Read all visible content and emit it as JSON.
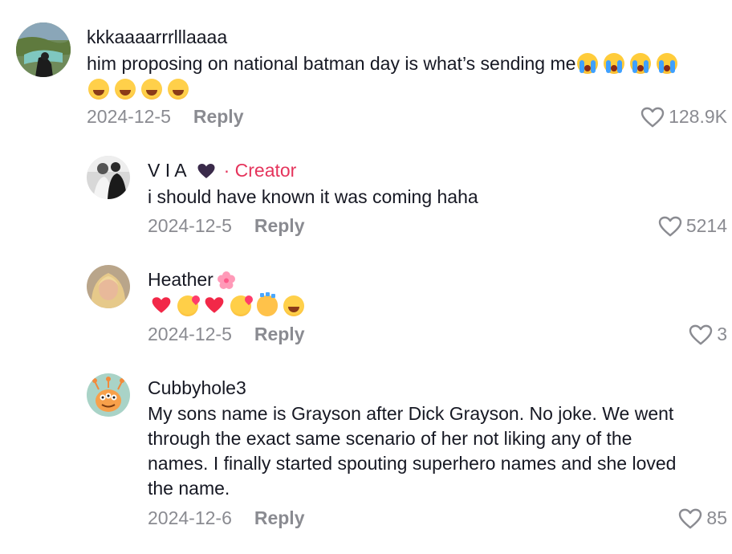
{
  "comments": [
    {
      "username": "kkkaaaarrrlllaaaa",
      "text": "him proposing on national batman day is what’s sending me",
      "text_emojis": [
        "crying-face",
        "crying-face",
        "crying-face",
        "crying-face"
      ],
      "emoji_line": [
        "laughing-face",
        "laughing-face",
        "laughing-face",
        "laughing-face"
      ],
      "date": "2024-12-5",
      "reply_label": "Reply",
      "likes": "128.9K"
    },
    {
      "username": "V I A",
      "badge": "· Creator",
      "text": "i should have known it was coming haha",
      "date": "2024-12-5",
      "reply_label": "Reply",
      "likes": "5214"
    },
    {
      "username": "Heather",
      "emoji_line": [
        "red-heart",
        "smiling-hearts-face",
        "red-heart",
        "smiling-hearts-face",
        "clapping-hands",
        "laughing-face"
      ],
      "date": "2024-12-5",
      "reply_label": "Reply",
      "likes": "3"
    },
    {
      "username": "Cubbyhole3",
      "text_lines": [
        "My sons name is Grayson after Dick Grayson. No joke. We went",
        "through the exact same scenario of her not liking any of the",
        "names. I finally started spouting superhero names and she loved",
        "the name."
      ],
      "date": "2024-12-6",
      "reply_label": "Reply",
      "likes": "85"
    }
  ],
  "colors": {
    "creator": "#e5345c",
    "meta": "#8a8b91",
    "text": "#161823"
  }
}
